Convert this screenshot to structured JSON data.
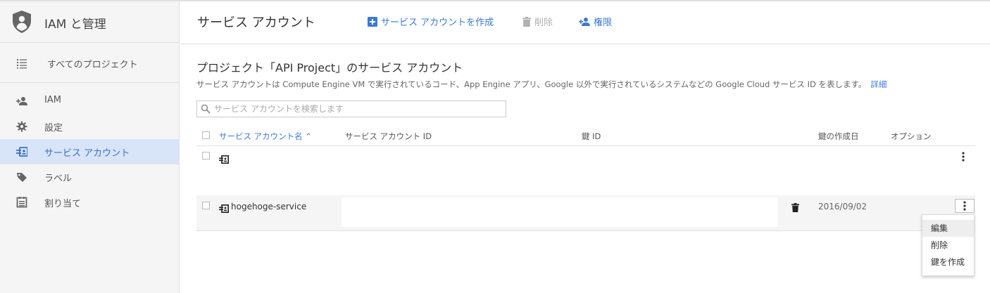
{
  "sidebar": {
    "product_title": "IAM と管理",
    "all_projects": "すべてのプロジェクト",
    "items": [
      {
        "label": "IAM",
        "icon": "person-add-icon"
      },
      {
        "label": "設定",
        "icon": "gear-icon"
      },
      {
        "label": "サービス アカウント",
        "icon": "service-account-icon",
        "active": true
      },
      {
        "label": "ラベル",
        "icon": "tag-icon"
      },
      {
        "label": "割り当て",
        "icon": "quota-icon"
      }
    ]
  },
  "header": {
    "title": "サービス アカウント",
    "create_label": "サービス アカウントを作成",
    "delete_label": "削除",
    "permissions_label": "権限"
  },
  "main": {
    "section_title": "プロジェクト「API Project」のサービス アカウント",
    "description": "サービス アカウントは Compute Engine VM で実行されているコード、App Engine アプリ、Google 以外で実行されているシステムなどの Google Cloud サービス ID を表します。",
    "details_link": "詳細",
    "search_placeholder": "サービス アカウントを検索します"
  },
  "table": {
    "columns": {
      "name": "サービス アカウント名 ⌃",
      "id": "サービス アカウント ID",
      "key_id": "鍵 ID",
      "key_created": "鍵の作成日",
      "options": "オプション"
    },
    "rows": [
      {
        "name": "",
        "id": "",
        "key_id": "",
        "key_created": ""
      },
      {
        "name": "hogehoge-service",
        "id": "",
        "key_id": "",
        "key_created": "2016/09/02"
      }
    ]
  },
  "context_menu": {
    "items": [
      "編集",
      "削除",
      "鍵を作成"
    ]
  },
  "colors": {
    "accent": "#3a79d6",
    "active_bg": "#d8e4f7",
    "sidebar_bg": "#f5f5f5"
  }
}
